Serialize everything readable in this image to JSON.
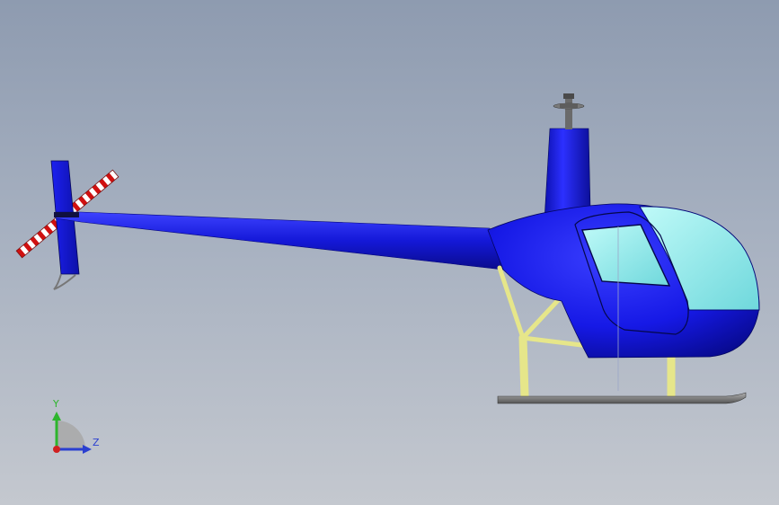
{
  "viewport": {
    "background_top": "#8e9bb0",
    "background_bottom": "#c4c8cf",
    "model": "helicopter"
  },
  "colors": {
    "fuselage": "#1a1fe0",
    "canopy": "#8ff0f0",
    "strut": "#e6e68a",
    "skid": "#8a8a8a",
    "rotor_stripe_red": "#d01010",
    "rotor_stripe_white": "#ffffff"
  },
  "triad": {
    "icon": "coordinate-triad-icon",
    "y_label": "Y",
    "z_label": "Z",
    "x_color": "#d02020",
    "y_color": "#2db52d",
    "z_color": "#2a3fd0"
  }
}
